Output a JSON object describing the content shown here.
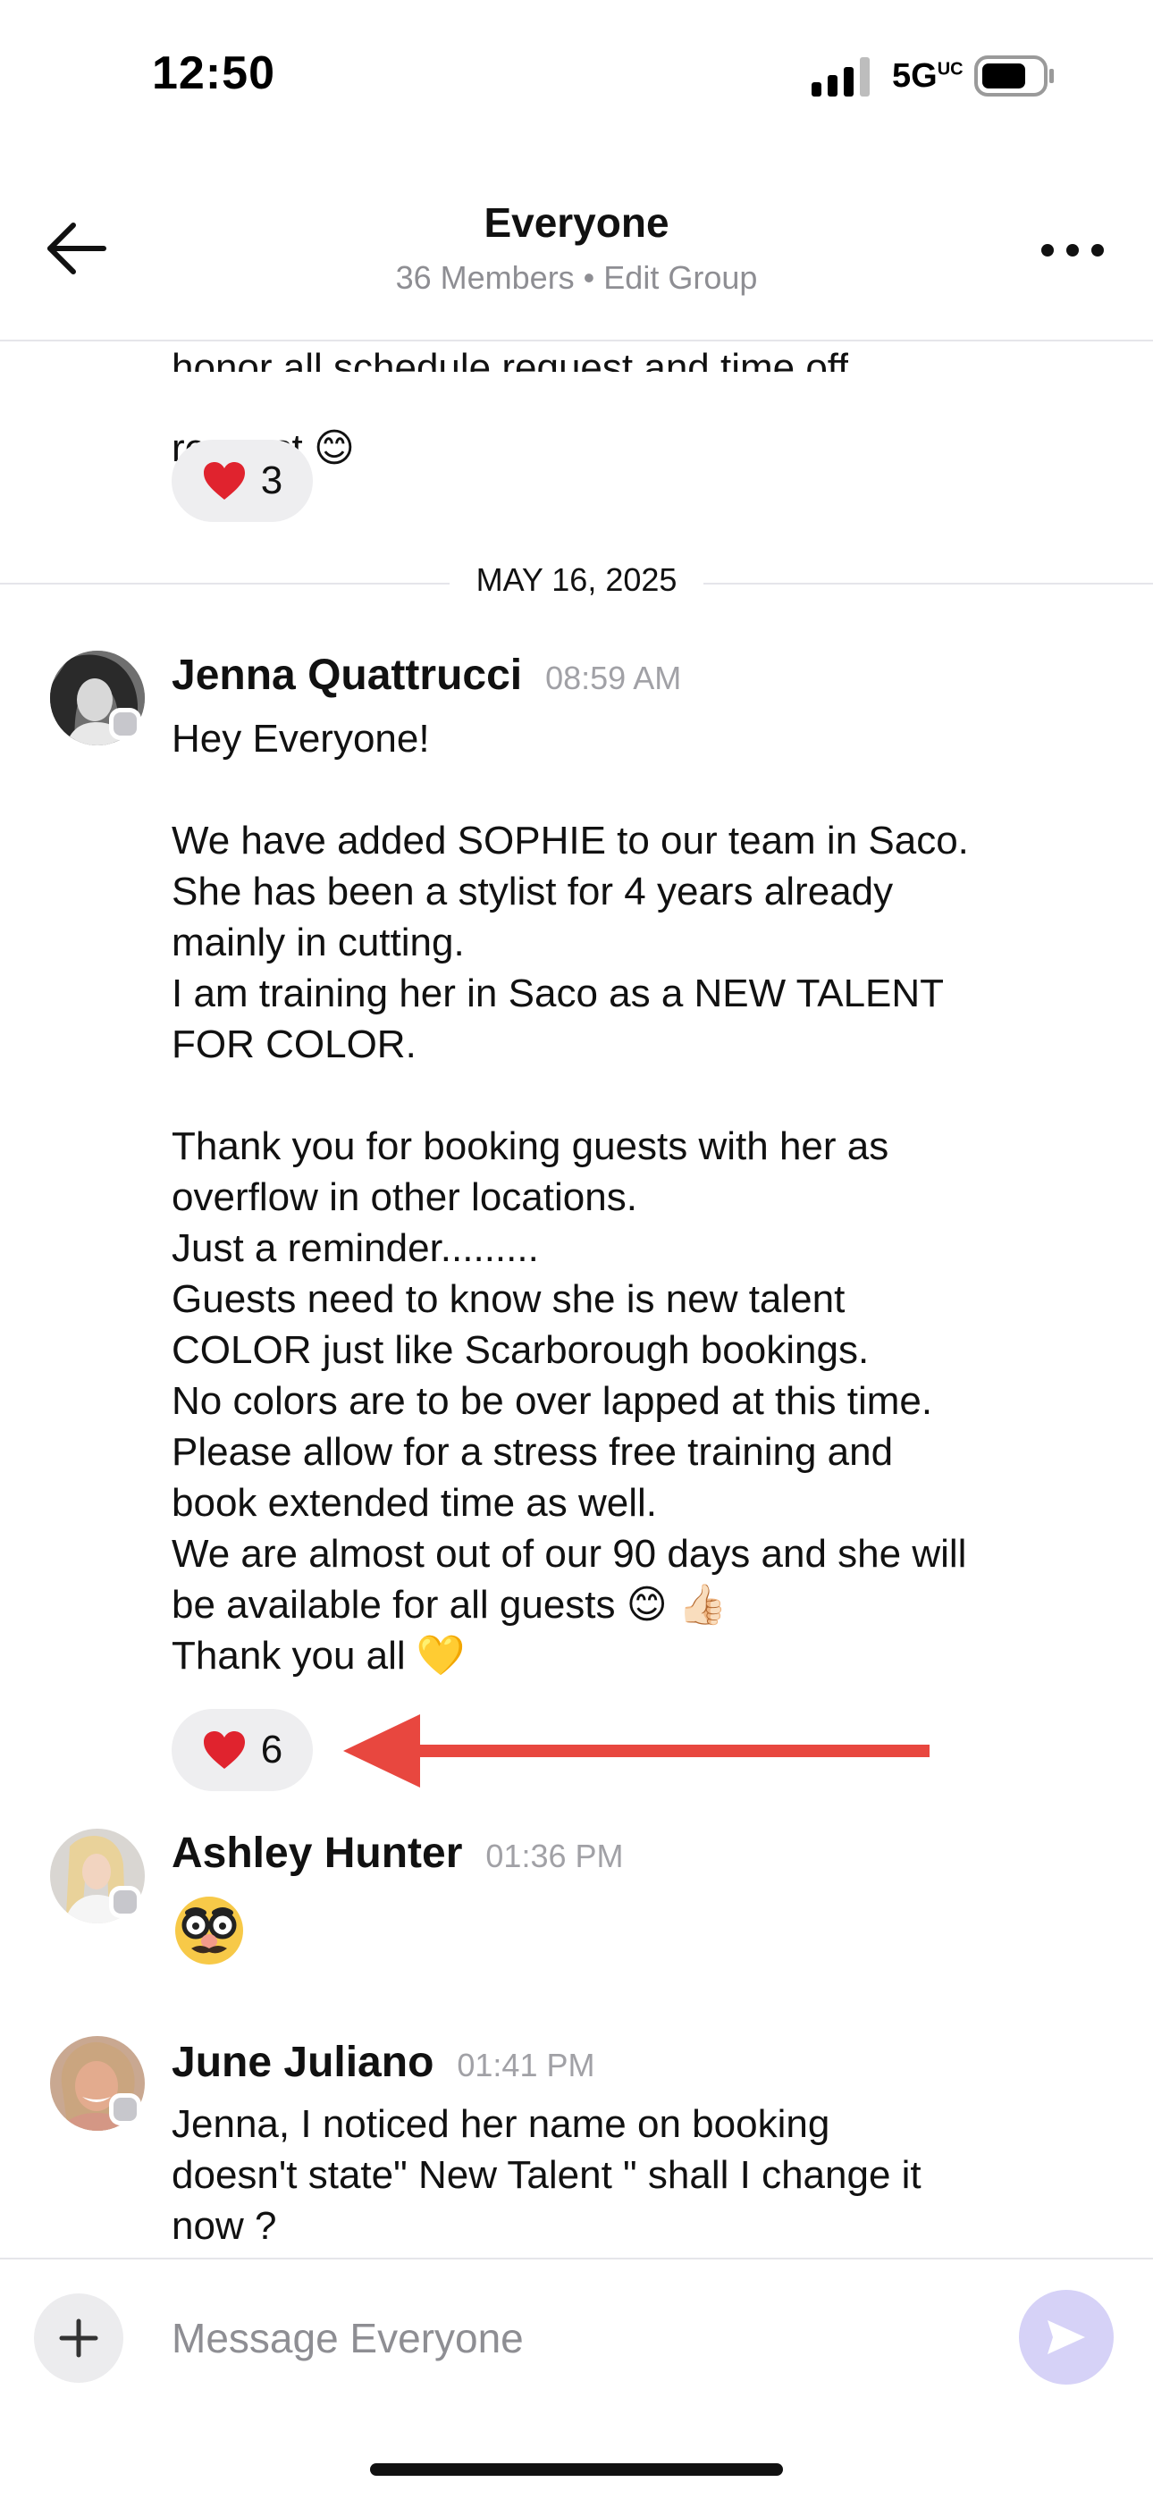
{
  "status_bar": {
    "time": "12:50",
    "network": "5G",
    "network_sup": "UC",
    "battery_level": 0.75
  },
  "header": {
    "title": "Everyone",
    "subtitle": "36 Members • Edit Group"
  },
  "messages": {
    "partial": {
      "text_line1": "honor all schedule request and time off",
      "text_line2": "request 😊",
      "reaction_emoji": "heart",
      "reaction_count": "3"
    },
    "date_divider": "MAY 16, 2025",
    "jenna": {
      "sender": "Jenna Quattrucci",
      "time": "08:59 AM",
      "text": "Hey Everyone!\n\nWe have added SOPHIE to our team in Saco.\nShe has been a stylist for 4 years already\nmainly in cutting.\nI am training her in Saco as a NEW TALENT\nFOR COLOR.\n\nThank you for booking guests with her as\noverflow in other locations.\nJust a reminder.........\nGuests need to know she is new talent\nCOLOR just like Scarborough bookings.\nNo colors are to be over lapped at this time.\nPlease allow for a stress free training and\nbook extended time as well.\nWe are almost out of our 90 days and she will\nbe available for all guests 😊 👍🏻\nThank you all 💛",
      "reaction_emoji": "heart",
      "reaction_count": "6"
    },
    "ashley": {
      "sender": "Ashley Hunter",
      "time": "01:36 PM",
      "emoji": "disguised-face"
    },
    "june": {
      "sender": "June Juliano",
      "time": "01:41 PM",
      "text": "Jenna, I noticed her name on booking\ndoesn't state\" New Talent \" shall I change it\nnow ?"
    }
  },
  "composer": {
    "placeholder": "Message Everyone"
  },
  "colors": {
    "accent_send": "#d6d2f7",
    "annotation_arrow": "#e8473f",
    "reaction_bg": "#eeeef0",
    "heart": "#e0232e"
  }
}
